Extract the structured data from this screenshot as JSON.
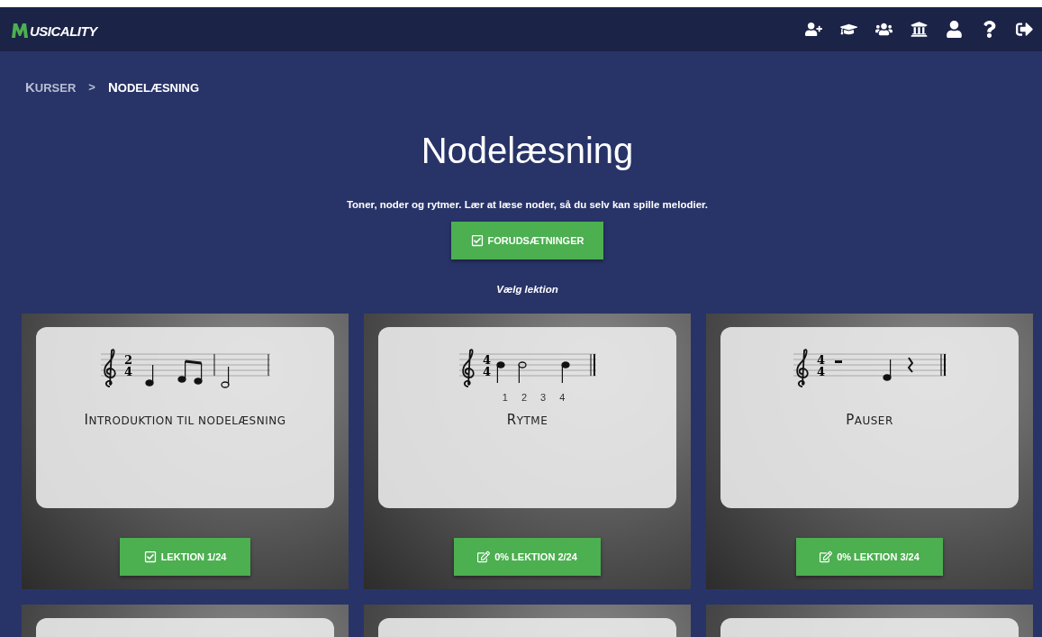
{
  "logo": {
    "text": "USICALITY"
  },
  "breadcrumb": [
    {
      "label": "KURSER",
      "current": false
    },
    {
      "label": "NODELÆSNING",
      "current": true
    }
  ],
  "breadcrumb_separator": ">",
  "title": "Nodelæsning",
  "description": "Toner, noder og rytmer. Lær at læse noder, så du selv kan spille melodier.",
  "prerequisites_button": "FORUDSÆTNINGER",
  "choose_label": "Vælg lektion",
  "cards": [
    {
      "kind": "intro",
      "title": "INTRODUKTION TIL NODELÆSNING",
      "time_signature": [
        "2",
        "4"
      ],
      "button": "LEKTION 1/24",
      "completed": true
    },
    {
      "kind": "rhythm",
      "title": "RYTME",
      "time_signature": [
        "4",
        "4"
      ],
      "beats": [
        "1",
        "2",
        "3",
        "4"
      ],
      "button": "0% LEKTION 2/24",
      "completed": false
    },
    {
      "kind": "rests",
      "title": "PAUSER",
      "time_signature": [
        "4",
        "4"
      ],
      "button": "0% LEKTION 3/24",
      "completed": false
    },
    {
      "kind": "partial"
    },
    {
      "kind": "partial"
    },
    {
      "kind": "partial"
    }
  ]
}
